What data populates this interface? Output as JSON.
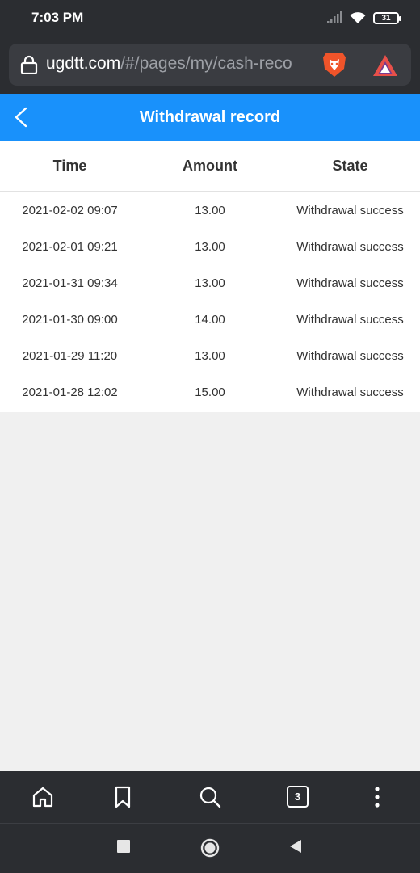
{
  "status_bar": {
    "time": "7:03 PM",
    "battery": "31",
    "icons": [
      "signal-icon",
      "wifi-icon",
      "battery-icon"
    ]
  },
  "browser": {
    "url_host": "ugdtt.com",
    "url_path": "/#/pages/my/cash-reco",
    "icons": [
      "lock-icon",
      "brave-lion-icon",
      "brave-rewards-icon"
    ]
  },
  "header": {
    "title": "Withdrawal record",
    "accent_color": "#1991fb"
  },
  "table": {
    "columns": [
      "Time",
      "Amount",
      "State"
    ],
    "rows": [
      {
        "time": "2021-02-02 09:07",
        "amount": "13.00",
        "state": "Withdrawal success"
      },
      {
        "time": "2021-02-01 09:21",
        "amount": "13.00",
        "state": "Withdrawal success"
      },
      {
        "time": "2021-01-31 09:34",
        "amount": "13.00",
        "state": "Withdrawal success"
      },
      {
        "time": "2021-01-30 09:00",
        "amount": "14.00",
        "state": "Withdrawal success"
      },
      {
        "time": "2021-01-29 11:20",
        "amount": "13.00",
        "state": "Withdrawal success"
      },
      {
        "time": "2021-01-28 12:02",
        "amount": "15.00",
        "state": "Withdrawal success"
      }
    ]
  },
  "bottom_nav": {
    "tab_count": "3",
    "icons": [
      "home-icon",
      "bookmark-icon",
      "search-icon",
      "tabs-icon",
      "more-icon"
    ]
  },
  "system_nav": {
    "icons": [
      "recents-icon",
      "home-circle-icon",
      "back-triangle-icon"
    ]
  }
}
